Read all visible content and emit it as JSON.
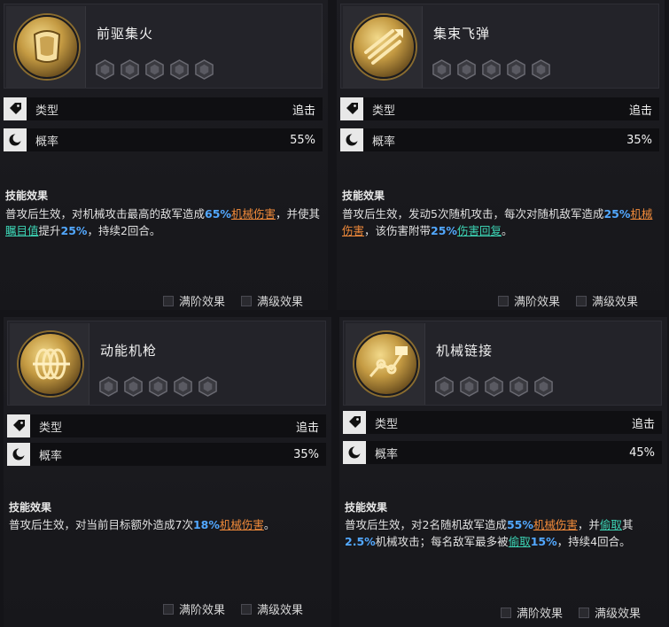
{
  "labels": {
    "type": "类型",
    "chance": "概率",
    "effect_title": "技能效果",
    "full_stage": "满阶效果",
    "full_level": "满级效果"
  },
  "cards": [
    {
      "name": "前驱集火",
      "type_value": "追击",
      "chance_value": "55%",
      "effect": [
        {
          "t": "普攻后生效，对机械攻击最高的敌军造成"
        },
        {
          "t": "65%",
          "c": "blue"
        },
        {
          "t": "机械伤害",
          "c": "orange"
        },
        {
          "t": "，并使其"
        },
        {
          "t": "瞩目值",
          "c": "teal"
        },
        {
          "t": "提升"
        },
        {
          "t": "25%",
          "c": "blue"
        },
        {
          "t": "，持续2回合。"
        }
      ]
    },
    {
      "name": "集束飞弹",
      "type_value": "追击",
      "chance_value": "35%",
      "effect": [
        {
          "t": "普攻后生效，发动5次随机攻击，每次对随机敌军造成"
        },
        {
          "t": "25%",
          "c": "blue"
        },
        {
          "t": "机械伤害",
          "c": "orange"
        },
        {
          "t": "，该伤害附带"
        },
        {
          "t": "25%",
          "c": "blue"
        },
        {
          "t": "伤害回复",
          "c": "teal"
        },
        {
          "t": "。"
        }
      ]
    },
    {
      "name": "动能机枪",
      "type_value": "追击",
      "chance_value": "35%",
      "effect": [
        {
          "t": "普攻后生效，对当前目标额外造成7次"
        },
        {
          "t": "18%",
          "c": "blue"
        },
        {
          "t": "机械伤害",
          "c": "orange"
        },
        {
          "t": "。"
        }
      ]
    },
    {
      "name": "机械链接",
      "type_value": "追击",
      "chance_value": "45%",
      "effect": [
        {
          "t": "普攻后生效，对2名随机敌军造成"
        },
        {
          "t": "55%",
          "c": "blue"
        },
        {
          "t": "机械伤害",
          "c": "orange"
        },
        {
          "t": "，并"
        },
        {
          "t": "偷取",
          "c": "teal"
        },
        {
          "t": "其"
        },
        {
          "t": "2.5%",
          "c": "blue"
        },
        {
          "t": "机械攻击；每名敌军最多被"
        },
        {
          "t": "偷取",
          "c": "teal"
        },
        {
          "t": "15%",
          "c": "blue"
        },
        {
          "t": "，持续4回合。"
        }
      ]
    }
  ],
  "icons": {
    "star_slot": "hexagon-star-slot-icon",
    "tag": "tag-icon",
    "moon": "crescent-moon-icon",
    "skill_icons": [
      "armor-chest-icon",
      "missile-barrage-icon",
      "spiral-gun-icon",
      "mech-arm-icon"
    ]
  },
  "colors": {
    "orange": "#f08a3a",
    "blue": "#52a8ff",
    "teal": "#3cd3b4",
    "gold": "#c49a42"
  }
}
